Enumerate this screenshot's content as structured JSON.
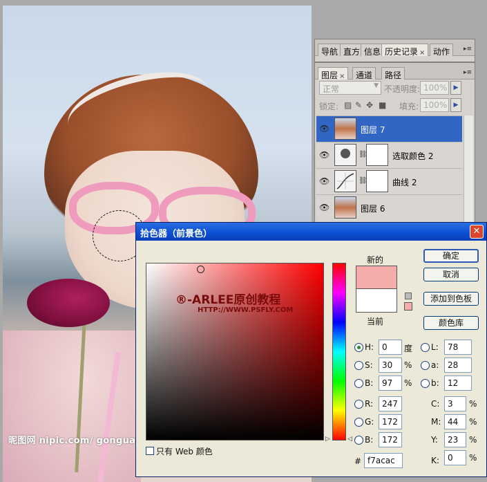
{
  "photo": {
    "watermark": "昵图网 nipic.com/ gonguar"
  },
  "history_panel": {
    "tabs": [
      "导航",
      "直方",
      "信息",
      "历史记录",
      "动作"
    ],
    "close_glyph": "×"
  },
  "layers_panel": {
    "tabs": [
      "图层",
      "通道",
      "路径"
    ],
    "blend_mode": "正常",
    "opacity_label": "不透明度:",
    "opacity_value": "100%",
    "lock_label": "锁定:",
    "fill_label": "填充:",
    "fill_value": "100%",
    "layers": [
      {
        "name": "图层 7",
        "selected": true
      },
      {
        "name": "选取颜色 2",
        "selected": false
      },
      {
        "name": "曲线 2",
        "selected": false
      },
      {
        "name": "图层 6",
        "selected": false
      }
    ]
  },
  "picker": {
    "title": "拾色器（前景色）",
    "close": "✕",
    "logo": "®-ARLEE原创教程",
    "logo_url": "HTTP://WWW.PSFLY.COM",
    "new_label": "新的",
    "current_label": "当前",
    "buttons": {
      "ok": "确定",
      "cancel": "取消",
      "add_swatch": "添加到色板",
      "libraries": "颜色库"
    },
    "only_web": "只有 Web 颜色",
    "hsb": {
      "H": "0",
      "S": "30",
      "B": "97",
      "h_unit": "度",
      "s_unit": "%",
      "b_unit": "%"
    },
    "rgb": {
      "R": "247",
      "G": "172",
      "B": "172"
    },
    "lab": {
      "L": "78",
      "a": "28",
      "b": "12"
    },
    "cmyk": {
      "C": "3",
      "M": "44",
      "Y": "23",
      "K": "0",
      "unit": "%"
    },
    "hex_label": "#",
    "hex": "f7acac",
    "labels": {
      "H": "H:",
      "S": "S:",
      "B": "B:",
      "R": "R:",
      "G": "G:",
      "B2": "B:",
      "L": "L:",
      "a": "a:",
      "b": "b:",
      "C": "C:",
      "M": "M:",
      "Y": "Y:",
      "K": "K:"
    },
    "new_color": "#f7acac",
    "current_color": "#ffffff"
  }
}
